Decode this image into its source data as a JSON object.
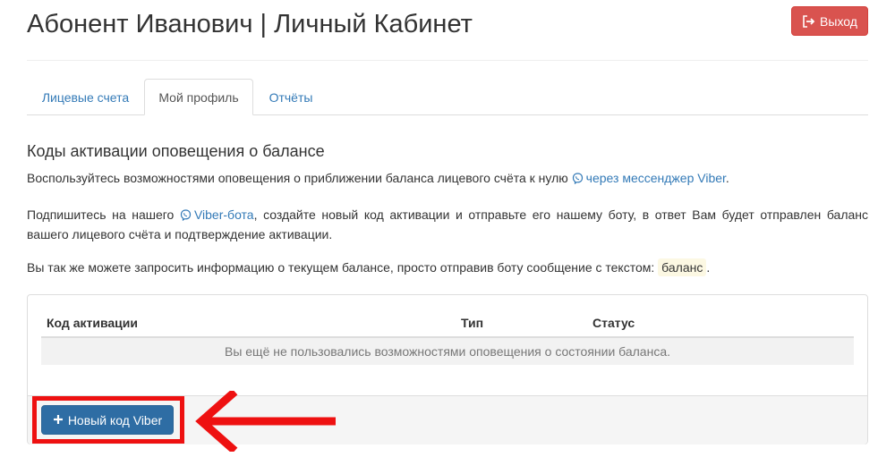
{
  "header": {
    "title": "Абонент Иванович | Личный Кабинет",
    "logout_label": "Выход"
  },
  "tabs": [
    {
      "label": "Лицевые счета",
      "active": false
    },
    {
      "label": "Мой профиль",
      "active": true
    },
    {
      "label": "Отчёты",
      "active": false
    }
  ],
  "section": {
    "title": "Коды активации оповещения о балансе",
    "p1_text": "Воспользуйтесь возможностями оповещения о приближении баланса лицевого счёта к нулю",
    "p1_link": "через мессенджер Viber",
    "p1_end": ".",
    "p2_start": "Подпишитесь на нашего",
    "p2_link": "Viber-бота",
    "p2_rest": ", создайте новый код активации и отправьте его нашему боту, в ответ Вам будет отправлен баланс вашего лицевого счёта и подтверждение активации.",
    "p3_text": "Вы так же можете запросить информацию о текущем балансе, просто отправив боту сообщение с текстом:",
    "p3_code": "баланс",
    "p3_end": "."
  },
  "table": {
    "columns": [
      "Код активации",
      "Тип",
      "Статус"
    ],
    "empty_message": "Вы ещё не пользовались возможностями оповещения о состоянии баланса."
  },
  "actions": {
    "new_code_label": "Новый код Viber"
  },
  "colors": {
    "danger": "#d9534f",
    "primary": "#2e6da4",
    "link": "#337ab7",
    "annotation": "#ee1111"
  },
  "icons": {
    "logout": "sign-out-icon",
    "viber": "viber-icon",
    "plus": "plus-icon",
    "annotation_arrow": "arrow-left-icon"
  }
}
